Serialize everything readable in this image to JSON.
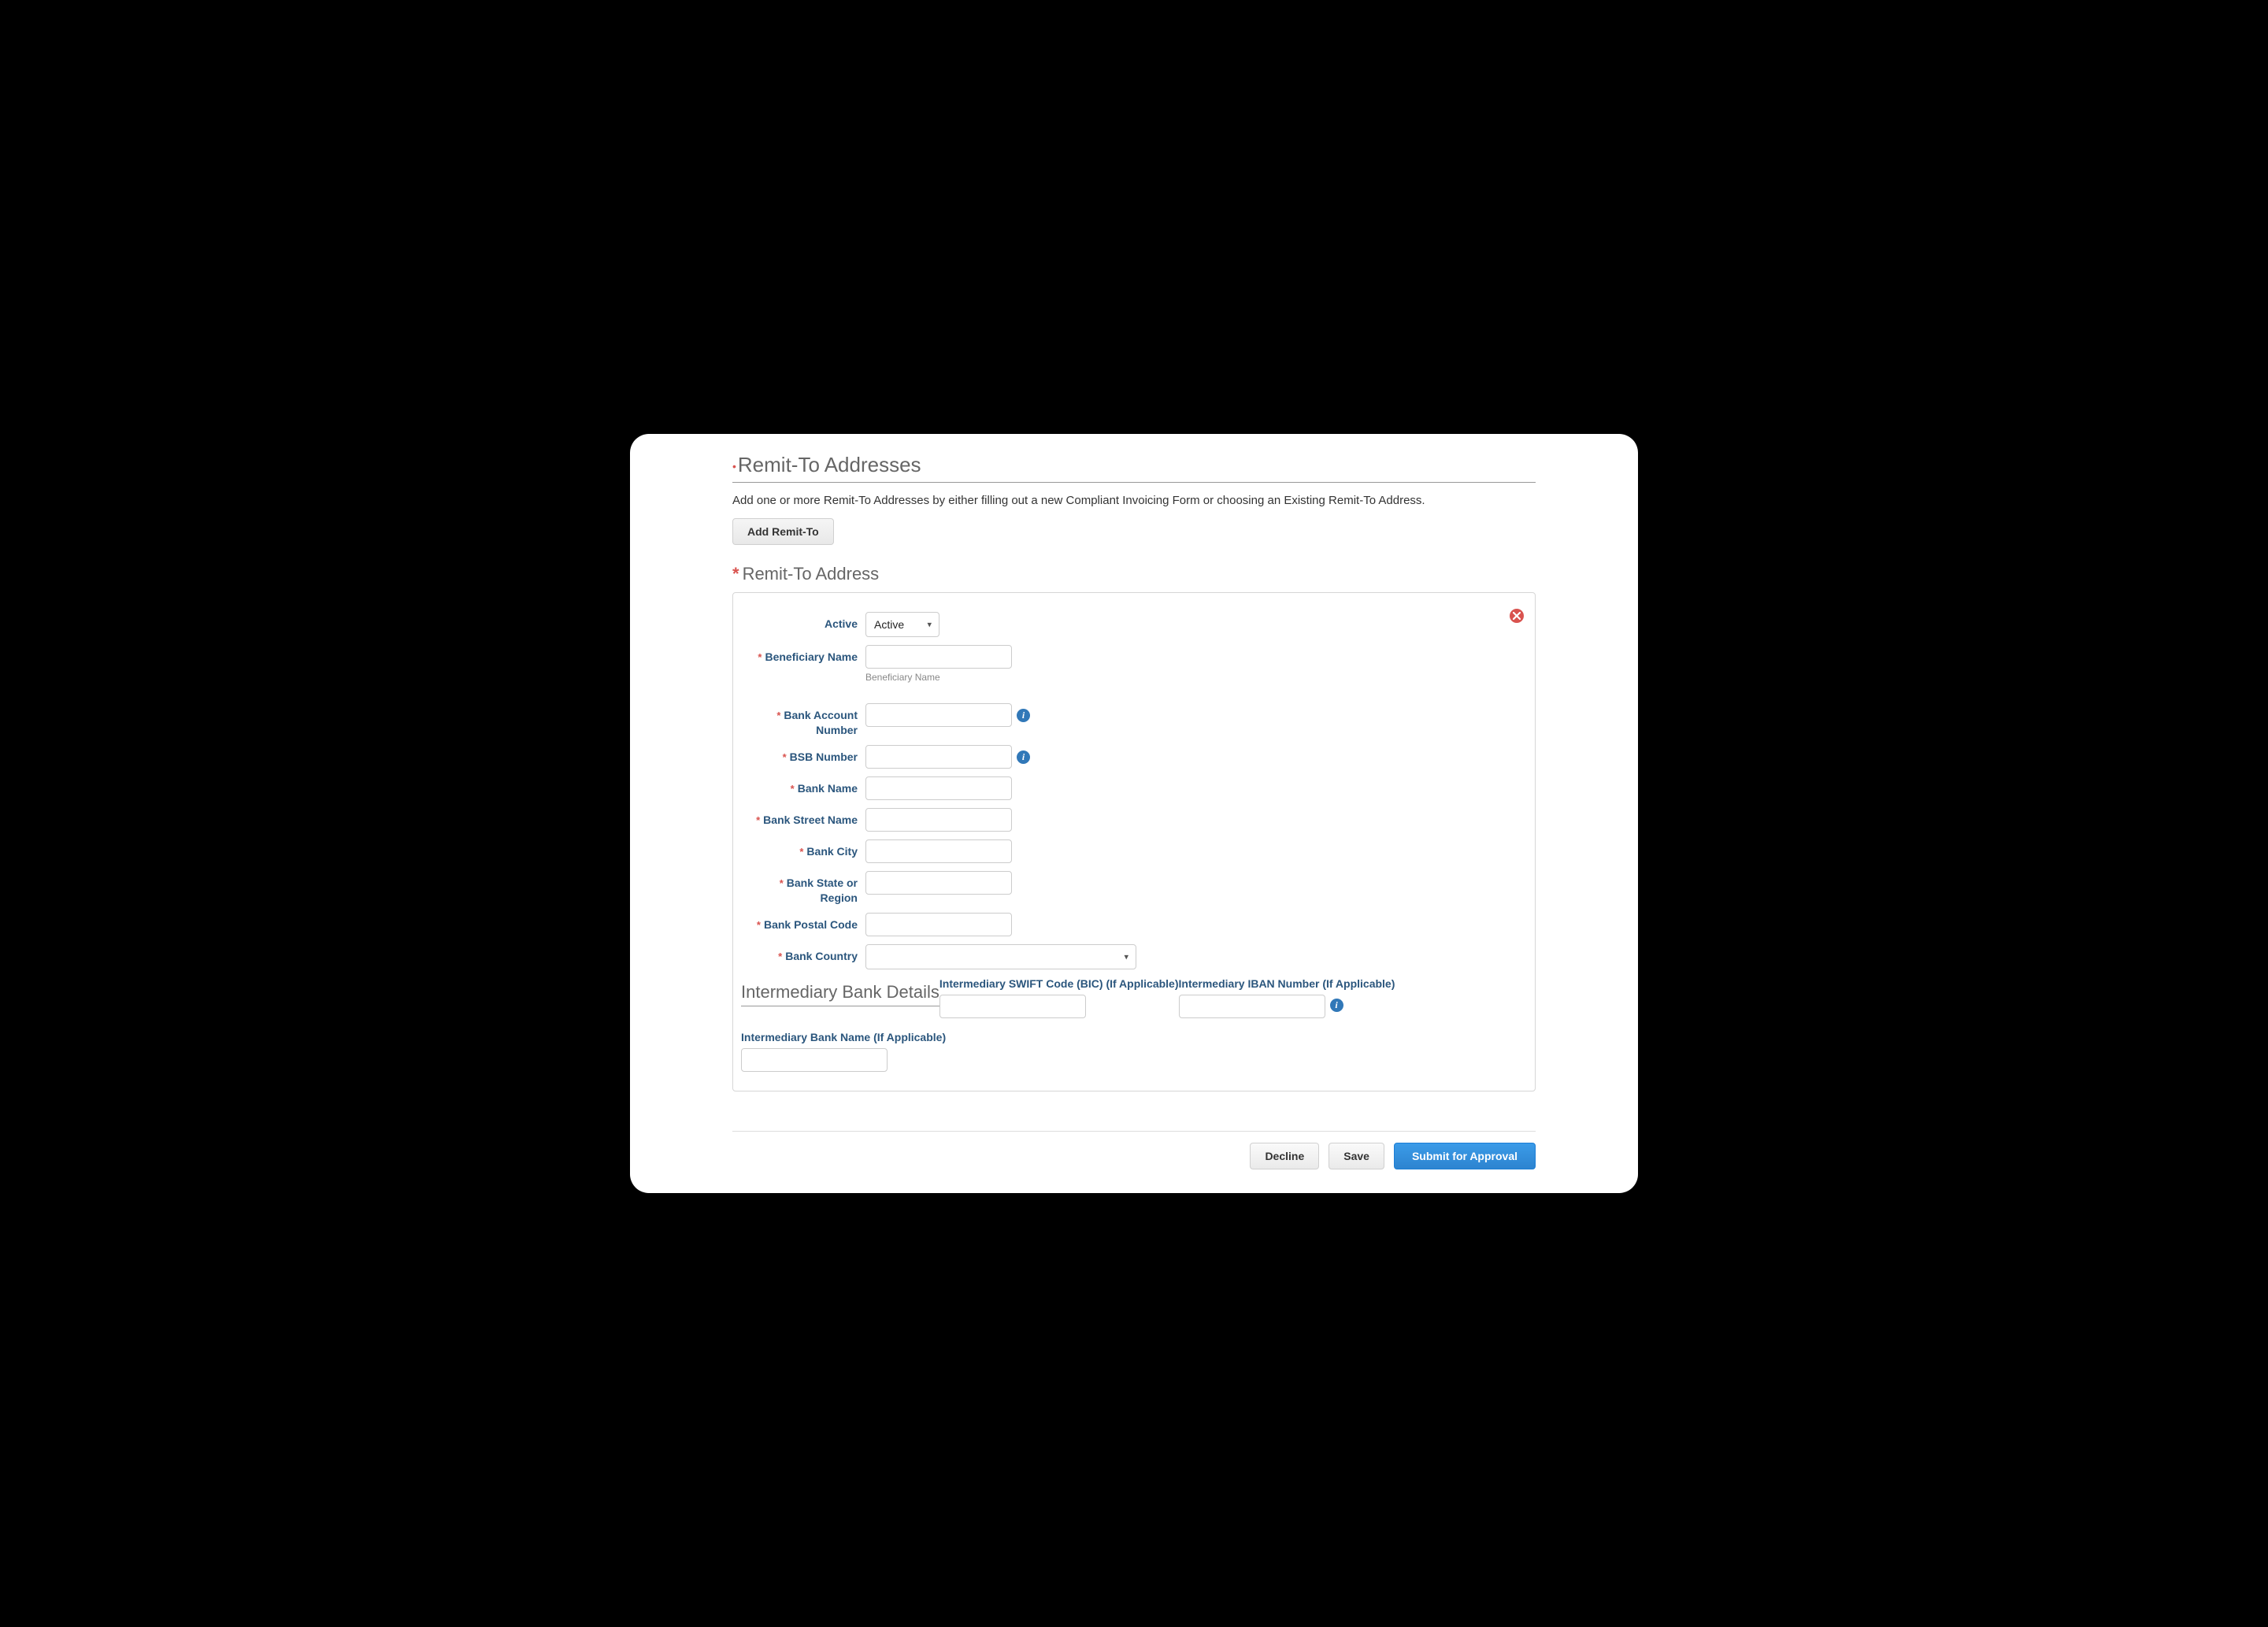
{
  "header": {
    "title": "Remit-To Addresses",
    "intro": "Add one or more Remit-To Addresses by either filling out a new Compliant Invoicing Form or choosing an Existing Remit-To Address.",
    "add_button": "Add Remit-To",
    "sub_title": "Remit-To Address"
  },
  "form": {
    "active": {
      "label": "Active",
      "value": "Active"
    },
    "beneficiary_name": {
      "label": "Beneficiary Name",
      "hint": "Beneficiary Name",
      "value": ""
    },
    "bank_account_number": {
      "label": "Bank Account Number",
      "value": ""
    },
    "bsb_number": {
      "label": "BSB Number",
      "value": ""
    },
    "bank_name": {
      "label": "Bank Name",
      "value": ""
    },
    "bank_street_name": {
      "label": "Bank Street Name",
      "value": ""
    },
    "bank_city": {
      "label": "Bank City",
      "value": ""
    },
    "bank_state_or_region": {
      "label": "Bank State or Region",
      "value": ""
    },
    "bank_postal_code": {
      "label": "Bank Postal Code",
      "value": ""
    },
    "bank_country": {
      "label": "Bank Country",
      "value": ""
    }
  },
  "intermediary": {
    "heading": "Intermediary Bank Details",
    "swift": {
      "label": "Intermediary SWIFT Code (BIC) (If Applicable)",
      "value": ""
    },
    "iban": {
      "label": "Intermediary IBAN Number (If Applicable)",
      "value": ""
    },
    "bank_name": {
      "label": "Intermediary Bank Name (If Applicable)",
      "value": ""
    }
  },
  "actions": {
    "decline": "Decline",
    "save": "Save",
    "submit": "Submit for Approval"
  }
}
